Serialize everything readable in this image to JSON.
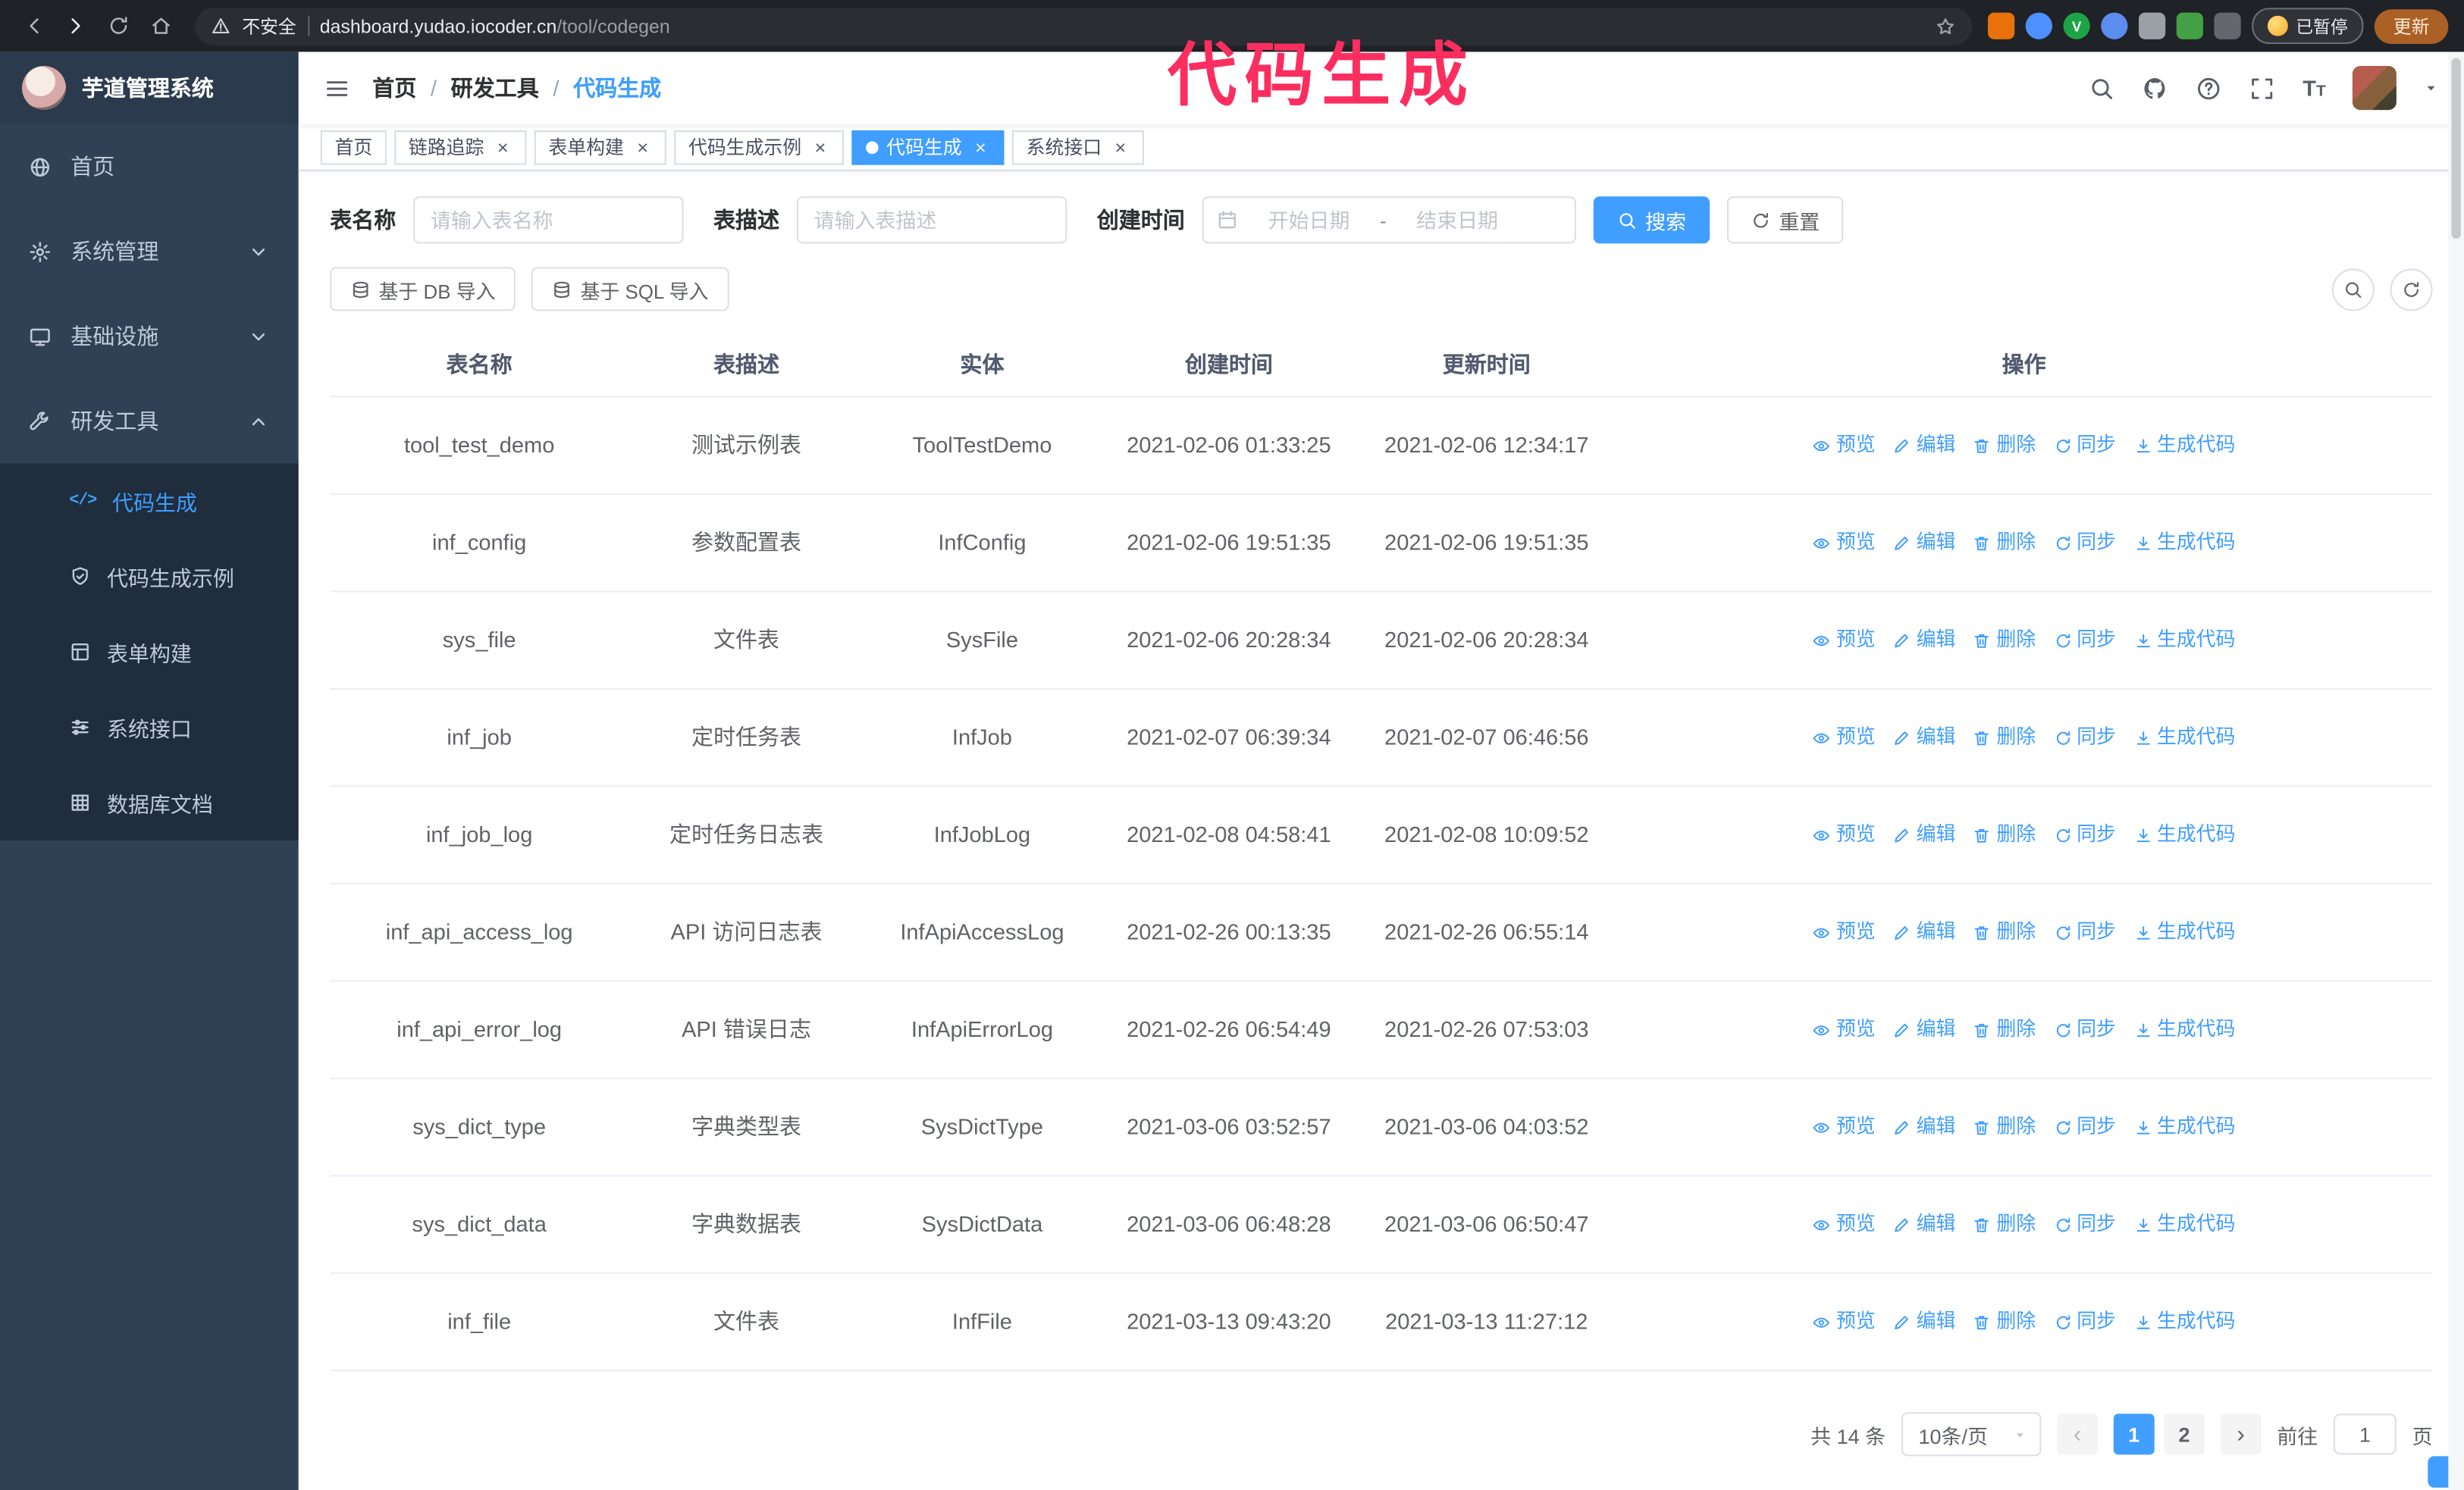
{
  "colors": {
    "accent": "#409eff",
    "sidebar_bg": "#304156",
    "submenu_bg": "#1f2d3d",
    "link": "#409eff",
    "annotation": "#fb2e5f",
    "chrome_bg": "#1f2226",
    "update_button_bg": "#ab6026"
  },
  "annotation": {
    "text": "代码生成"
  },
  "browser": {
    "security_label": "不安全",
    "url_domain": "dashboard.yudao.iocoder.cn",
    "url_path": "/tool/codegen",
    "extensions": [
      {
        "name": "fox-extension",
        "color": "#e8710a",
        "shape": "square",
        "glyph": ""
      },
      {
        "name": "drop-extension",
        "color": "#4d90fe",
        "shape": "circle",
        "glyph": ""
      },
      {
        "name": "check-extension",
        "color": "#1ea446",
        "shape": "circle",
        "glyph": "V"
      },
      {
        "name": "people-extension",
        "color": "#5b8def",
        "shape": "circle",
        "glyph": ""
      },
      {
        "name": "card-extension",
        "color": "#9aa0a6",
        "shape": "square",
        "glyph": ""
      },
      {
        "name": "leaf-extension",
        "color": "#43a047",
        "shape": "square",
        "glyph": ""
      },
      {
        "name": "puzzle-extension",
        "color": "#63666c",
        "shape": "square",
        "glyph": ""
      }
    ],
    "paused_badge": "已暂停",
    "update_button": "更新"
  },
  "app": {
    "title": "芋道管理系统",
    "breadcrumb": [
      "首页",
      "研发工具",
      "代码生成"
    ]
  },
  "sidebar": {
    "items": [
      {
        "name": "home",
        "label": "首页",
        "icon": "globe"
      },
      {
        "name": "system-management",
        "label": "系统管理",
        "icon": "gear",
        "chevron": "down"
      },
      {
        "name": "infrastructure",
        "label": "基础设施",
        "icon": "monitor",
        "chevron": "down"
      },
      {
        "name": "dev-tools",
        "label": "研发工具",
        "icon": "wrench",
        "chevron": "up",
        "children": [
          {
            "name": "codegen",
            "label": "代码生成",
            "icon": "code",
            "active": true
          },
          {
            "name": "codegen-example",
            "label": "代码生成示例",
            "icon": "shield-check"
          },
          {
            "name": "form-builder",
            "label": "表单构建",
            "icon": "form"
          },
          {
            "name": "system-api",
            "label": "系统接口",
            "icon": "sliders"
          },
          {
            "name": "db-doc",
            "label": "数据库文档",
            "icon": "table-grid"
          }
        ]
      }
    ]
  },
  "tabs": [
    {
      "name": "home",
      "label": "首页",
      "closable": false,
      "active": false
    },
    {
      "name": "tracing",
      "label": "链路追踪",
      "closable": true,
      "active": false
    },
    {
      "name": "form-builder",
      "label": "表单构建",
      "closable": true,
      "active": false
    },
    {
      "name": "codegen-example",
      "label": "代码生成示例",
      "closable": true,
      "active": false
    },
    {
      "name": "codegen",
      "label": "代码生成",
      "closable": true,
      "active": true
    },
    {
      "name": "system-api",
      "label": "系统接口",
      "closable": true,
      "active": false
    }
  ],
  "filters": {
    "table_name_label": "表名称",
    "table_name_placeholder": "请输入表名称",
    "table_desc_label": "表描述",
    "table_desc_placeholder": "请输入表描述",
    "create_time_label": "创建时间",
    "date_start_placeholder": "开始日期",
    "date_separator": "-",
    "date_end_placeholder": "结束日期",
    "search_button": "搜索",
    "reset_button": "重置"
  },
  "toolbar": {
    "import_db_label": "基于 DB 导入",
    "import_sql_label": "基于 SQL 导入"
  },
  "table": {
    "columns": [
      "表名称",
      "表描述",
      "实体",
      "创建时间",
      "更新时间",
      "操作"
    ],
    "actions": [
      {
        "name": "preview",
        "label": "预览",
        "icon": "eye"
      },
      {
        "name": "edit",
        "label": "编辑",
        "icon": "pencil"
      },
      {
        "name": "delete",
        "label": "删除",
        "icon": "trash"
      },
      {
        "name": "sync",
        "label": "同步",
        "icon": "refresh"
      },
      {
        "name": "generate-code",
        "label": "生成代码",
        "icon": "download"
      }
    ],
    "rows": [
      {
        "name": "tool_test_demo",
        "desc": "测试示例表",
        "entity": "ToolTestDemo",
        "created": "2021-02-06 01:33:25",
        "updated": "2021-02-06 12:34:17"
      },
      {
        "name": "inf_config",
        "desc": "参数配置表",
        "entity": "InfConfig",
        "created": "2021-02-06 19:51:35",
        "updated": "2021-02-06 19:51:35"
      },
      {
        "name": "sys_file",
        "desc": "文件表",
        "entity": "SysFile",
        "created": "2021-02-06 20:28:34",
        "updated": "2021-02-06 20:28:34"
      },
      {
        "name": "inf_job",
        "desc": "定时任务表",
        "entity": "InfJob",
        "created": "2021-02-07 06:39:34",
        "updated": "2021-02-07 06:46:56"
      },
      {
        "name": "inf_job_log",
        "desc": "定时任务日志表",
        "entity": "InfJobLog",
        "created": "2021-02-08 04:58:41",
        "updated": "2021-02-08 10:09:52"
      },
      {
        "name": "inf_api_access_log",
        "desc": "API 访问日志表",
        "entity": "InfApiAccessLog",
        "created": "2021-02-26 00:13:35",
        "updated": "2021-02-26 06:55:14"
      },
      {
        "name": "inf_api_error_log",
        "desc": "API 错误日志",
        "entity": "InfApiErrorLog",
        "created": "2021-02-26 06:54:49",
        "updated": "2021-02-26 07:53:03"
      },
      {
        "name": "sys_dict_type",
        "desc": "字典类型表",
        "entity": "SysDictType",
        "created": "2021-03-06 03:52:57",
        "updated": "2021-03-06 04:03:52"
      },
      {
        "name": "sys_dict_data",
        "desc": "字典数据表",
        "entity": "SysDictData",
        "created": "2021-03-06 06:48:28",
        "updated": "2021-03-06 06:50:47"
      },
      {
        "name": "inf_file",
        "desc": "文件表",
        "entity": "InfFile",
        "created": "2021-03-13 09:43:20",
        "updated": "2021-03-13 11:27:12"
      }
    ]
  },
  "pagination": {
    "total": "共 14 条",
    "page_size": "10条/页",
    "prev": "‹",
    "next": "›",
    "pages": [
      "1",
      "2"
    ],
    "active_page": "1",
    "goto_label": "前往",
    "goto_value": "1",
    "goto_suffix": "页"
  }
}
